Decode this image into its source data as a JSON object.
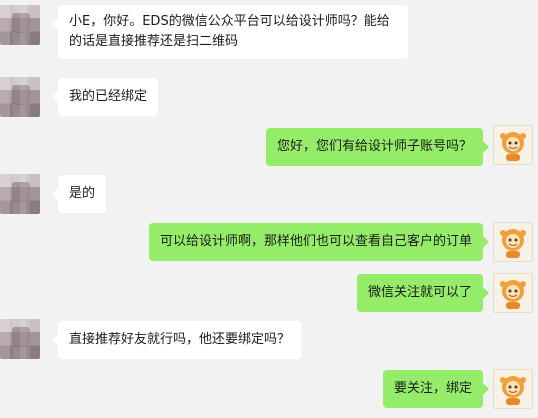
{
  "messages": [
    {
      "direction": "in",
      "text": "小E，你好。EDS的微信公众平台可以给设计师吗？能给的话是直接推荐还是扫二维码"
    },
    {
      "direction": "in",
      "text": "我的已经绑定"
    },
    {
      "direction": "out",
      "text": "您好，您们有给设计师子账号吗？"
    },
    {
      "direction": "in",
      "text": "是的"
    },
    {
      "direction": "out",
      "text": "可以给设计师啊，那样他们也可以查看自己客户的订单"
    },
    {
      "direction": "out",
      "text": "微信关注就可以了"
    },
    {
      "direction": "in",
      "text": "直接推荐好友就行吗，他还要绑定吗？"
    },
    {
      "direction": "out",
      "text": "要关注，绑定"
    }
  ],
  "icons": {
    "contact_avatar": "contact-avatar-blurred",
    "self_avatar": "cartoon-character-avatar"
  },
  "colors": {
    "background": "#f2f2f2",
    "incoming_bubble": "#ffffff",
    "outgoing_bubble": "#95ec69"
  }
}
